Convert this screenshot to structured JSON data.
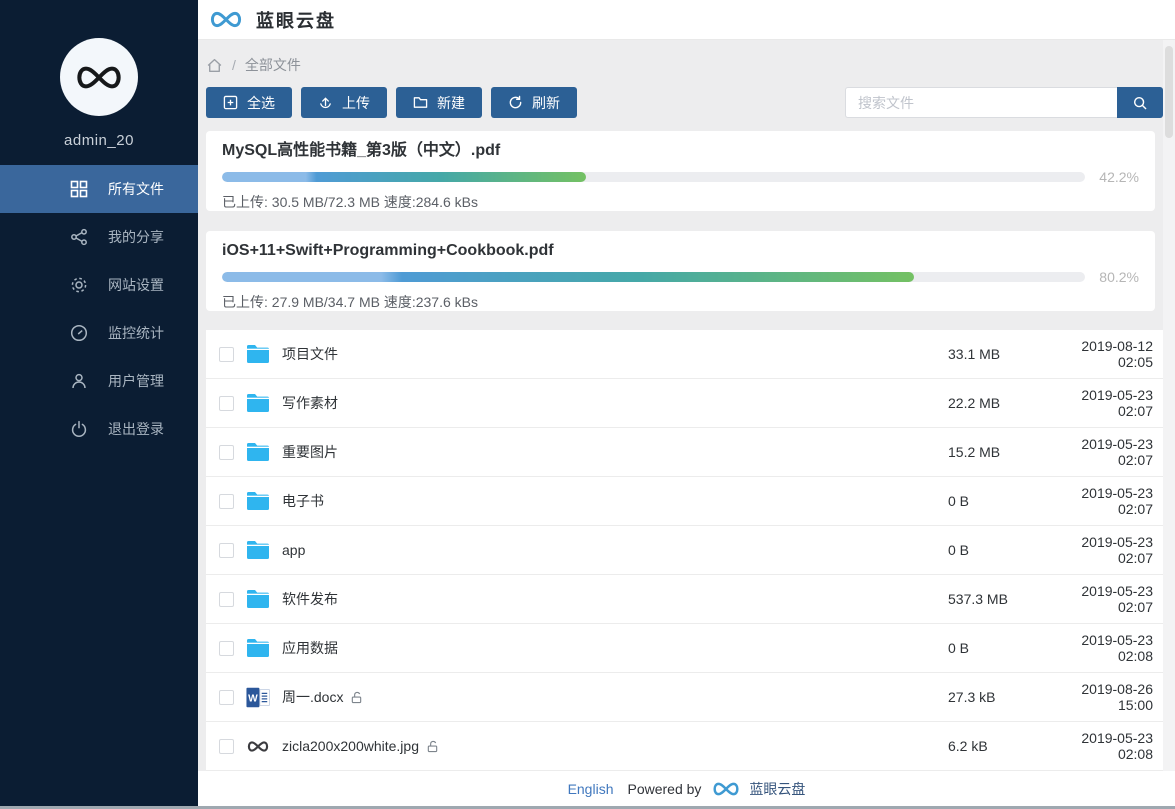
{
  "header": {
    "app_title": "蓝眼云盘"
  },
  "sidebar": {
    "username": "admin_20",
    "items": [
      {
        "label": "所有文件",
        "icon": "grid",
        "active": true
      },
      {
        "label": "我的分享",
        "icon": "share",
        "active": false
      },
      {
        "label": "网站设置",
        "icon": "gear",
        "active": false
      },
      {
        "label": "监控统计",
        "icon": "gauge",
        "active": false
      },
      {
        "label": "用户管理",
        "icon": "user",
        "active": false
      },
      {
        "label": "退出登录",
        "icon": "power",
        "active": false
      }
    ]
  },
  "breadcrumb": {
    "root_label": "全部文件"
  },
  "toolbar": {
    "select_all_label": "全选",
    "upload_label": "上传",
    "new_folder_label": "新建",
    "refresh_label": "刷新",
    "search_placeholder": "搜索文件"
  },
  "uploads": [
    {
      "filename": "MySQL高性能书籍_第3版（中文）.pdf",
      "progress_value": 42.2,
      "progress_percent": "42.2%",
      "status": "已上传: 30.5 MB/72.3 MB 速度:284.6 kBs"
    },
    {
      "filename": "iOS+11+Swift+Programming+Cookbook.pdf",
      "progress_value": 80.2,
      "progress_percent": "80.2%",
      "status": "已上传: 27.9 MB/34.7 MB 速度:237.6 kBs"
    }
  ],
  "files": [
    {
      "name": "项目文件",
      "type": "folder",
      "unlocked": false,
      "size": "33.1 MB",
      "date": "2019-08-12 02:05"
    },
    {
      "name": "写作素材",
      "type": "folder",
      "unlocked": false,
      "size": "22.2 MB",
      "date": "2019-05-23 02:07"
    },
    {
      "name": "重要图片",
      "type": "folder",
      "unlocked": false,
      "size": "15.2 MB",
      "date": "2019-05-23 02:07"
    },
    {
      "name": "电子书",
      "type": "folder",
      "unlocked": false,
      "size": "0 B",
      "date": "2019-05-23 02:07"
    },
    {
      "name": "app",
      "type": "folder",
      "unlocked": false,
      "size": "0 B",
      "date": "2019-05-23 02:07"
    },
    {
      "name": "软件发布",
      "type": "folder",
      "unlocked": false,
      "size": "537.3 MB",
      "date": "2019-05-23 02:07"
    },
    {
      "name": "应用数据",
      "type": "folder",
      "unlocked": false,
      "size": "0 B",
      "date": "2019-05-23 02:08"
    },
    {
      "name": "周一.docx",
      "type": "word",
      "unlocked": true,
      "size": "27.3 kB",
      "date": "2019-08-26 15:00"
    },
    {
      "name": "zicla200x200white.jpg",
      "type": "image-logo",
      "unlocked": true,
      "size": "6.2 kB",
      "date": "2019-05-23 02:08"
    }
  ],
  "footer": {
    "language_label": "English",
    "powered_by_label": "Powered by",
    "brand_label": "蓝眼云盘"
  },
  "colors": {
    "sidebar_bg": "#0b1d33",
    "sidebar_active_bg": "#3a679c",
    "primary_button_bg": "#2c6095",
    "folder_icon": "#2fb5ef",
    "link_blue": "#4178be",
    "brand_blue": "#3f9ad2",
    "progress_start": "#8cbbe8",
    "progress_mid": "#4f9bd5",
    "progress_teal": "#45a8a8",
    "progress_end": "#74c163",
    "content_bg": "#ededee",
    "percent_text": "#b6b6b6"
  }
}
